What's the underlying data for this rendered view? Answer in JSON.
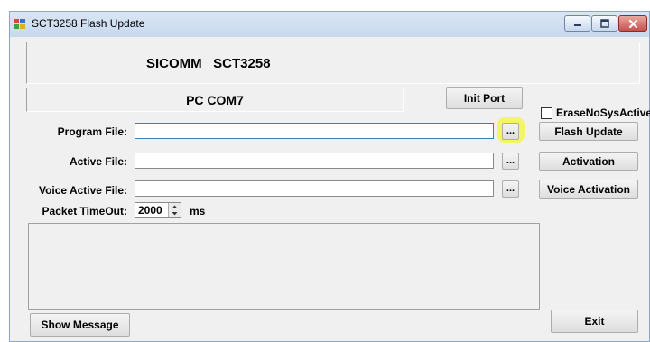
{
  "window": {
    "title": "SCT3258 Flash Update"
  },
  "header": {
    "model": "SICOMM   SCT3258"
  },
  "port": {
    "status": "PC COM7",
    "init_button": "Init Port"
  },
  "options": {
    "erase_checkbox_label": "EraseNoSysActive",
    "erase_checked": false
  },
  "fields": {
    "program_file_label": "Program File:",
    "program_file_value": "",
    "active_file_label": "Active File:",
    "active_file_value": "",
    "voice_active_file_label": "Voice Active File:",
    "voice_active_file_value": "",
    "browse_label": "...",
    "packet_timeout_label": "Packet TimeOut:",
    "packet_timeout_value": "2000",
    "packet_timeout_unit": "ms"
  },
  "actions": {
    "flash_update": "Flash Update",
    "activation": "Activation",
    "voice_activation": "Voice Activation",
    "show_message": "Show Message",
    "exit": "Exit"
  },
  "message_log": {
    "text": ""
  },
  "colors": {
    "highlight": "#f4f64a",
    "titlebar": "#c7d8ee",
    "close_button": "#c75050"
  },
  "icons": {
    "app": "app-icon",
    "minimize": "minimize-icon",
    "maximize": "maximize-icon",
    "close": "close-icon",
    "spinner_up": "spinner-up-icon",
    "spinner_down": "spinner-down-icon"
  }
}
